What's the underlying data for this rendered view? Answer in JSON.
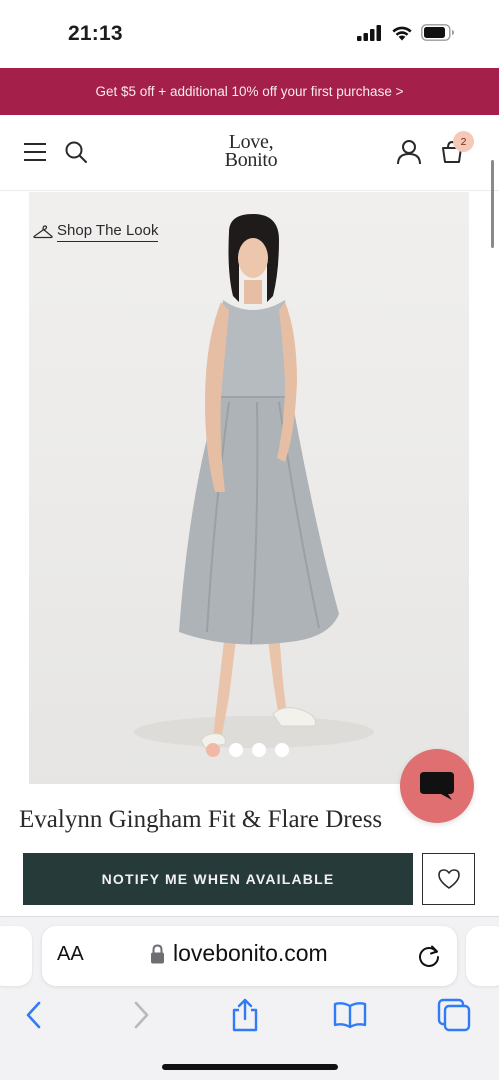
{
  "status_bar": {
    "time": "21:13"
  },
  "promo_banner": {
    "text": "Get $5 off + additional 10% off your first purchase >"
  },
  "header": {
    "logo_line1": "Love,",
    "logo_line2": "Bonito",
    "cart_count": "2"
  },
  "product": {
    "shop_the_look": "Shop The Look",
    "title": "Evalynn Gingham Fit & Flare Dress",
    "image_count": 4,
    "active_image_index": 0,
    "notify_button": "NOTIFY ME WHEN AVAILABLE"
  },
  "browser": {
    "text_size_label": "AA",
    "url": "lovebonito.com"
  },
  "icons": {
    "menu": "menu-icon",
    "search": "search-icon",
    "account": "user-icon",
    "cart": "bag-icon",
    "hanger": "hanger-icon",
    "chat": "chat-icon",
    "wishlist": "heart-icon",
    "lock": "lock-icon",
    "reload": "reload-icon",
    "back": "chevron-left-icon",
    "forward": "chevron-right-icon",
    "share": "share-icon",
    "bookmarks": "book-icon",
    "tabs": "tabs-icon"
  },
  "colors": {
    "promo_bg": "#a4204b",
    "notify_bg": "#273a3a",
    "chat_bg": "#df6f71",
    "accent_blue": "#2f7cf6",
    "dot_active": "#f2b8a6"
  }
}
